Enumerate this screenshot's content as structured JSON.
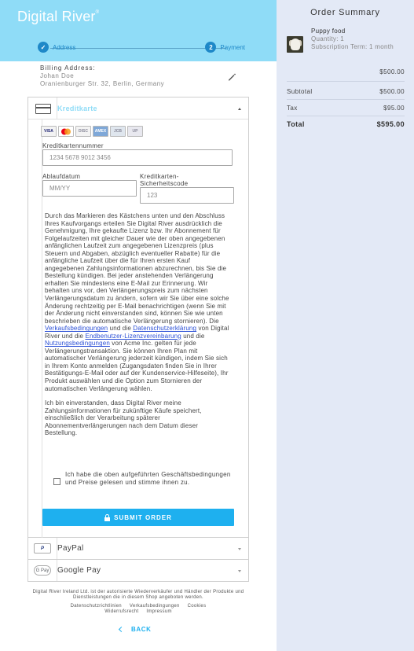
{
  "header": {
    "brand": "Digital River",
    "brand_mark": "®",
    "steps": [
      {
        "label": "Address",
        "done": true
      },
      {
        "label": "Payment",
        "number": "2"
      }
    ]
  },
  "billing": {
    "title": "Billing Address:",
    "name": "Johan Doe",
    "street": "Oranienburger Str. 32, Berlin, Germany"
  },
  "card": {
    "title": "Kreditkarte",
    "brands": [
      "VISA",
      "MC",
      "DISC",
      "AMEX",
      "JCB",
      "UP"
    ],
    "number_label": "Kreditkartennummer",
    "number_placeholder": "1234 5678 9012 3456",
    "expiry_label": "Ablaufdatum",
    "expiry_placeholder": "MM/YY",
    "cvc_label_1": "Kreditkarten-",
    "cvc_label_2": "Sicherheitscode",
    "cvc_placeholder": "123"
  },
  "terms": {
    "p1_a": "Durch das Markieren des Kästchens unten und den Abschluss Ihres Kaufvorgangs erteilen Sie Digital River ausdrücklich die Genehmigung, Ihre gekaufte Lizenz bzw. Ihr Abonnement für Folgelaufzeiten mit gleicher Dauer wie der oben angegebenen anfänglichen Laufzeit zum angegebenen Lizenzpreis (plus Steuern und Abgaben, abzüglich eventueller Rabatte) für die anfängliche Laufzeit über die für Ihren ersten Kauf angegebenen Zahlungsinformationen abzurechnen, bis Sie die Bestellung kündigen. Bei jeder anstehenden Verlängerung erhalten Sie mindestens eine E-Mail zur Erinnerung. Wir behalten uns vor, den Verlängerungspreis zum nächsten Verlängerungsdatum zu ändern, sofern wir Sie über eine solche Änderung rechtzeitig per E-Mail benachrichtigen (wenn Sie mit der Änderung nicht einverstanden sind, können Sie wie unten beschrieben die automatische Verlängerung stornieren). Die ",
    "link1": "Verkaufsbedingungen",
    "p1_b": " und die ",
    "link2": "Datenschutzerklärung",
    "p1_c": " von Digital River und die ",
    "link3": "Endbenutzer-Lizenzvereinbarung",
    "p1_d": " und die ",
    "link4": "Nutzungsbedingungen",
    "p1_e": " von Acme Inc. gelten für jede Verlängerungstransaktion. Sie können Ihren Plan mit automatischer Verlängerung jederzeit kündigen, indem Sie sich in Ihrem Konto anmelden (Zugangsdaten finden Sie in Ihrer Bestätigungs-E-Mail oder auf der Kundenservice-Hilfeseite), Ihr Produkt auswählen und die Option zum Stornieren der automatischen Verlängerung wählen.",
    "p2": "Ich bin einverstanden, dass Digital River meine Zahlungsinformationen für zukünftige Käufe speichert, einschließlich der Verarbeitung späterer Abonnementverlängerungen nach dem Datum dieser Bestellung.",
    "consent": "Ich habe die oben aufgeführten Geschäftsbedingungen und Preise gelesen und stimme ihnen zu."
  },
  "submit_label": "SUBMIT ORDER",
  "paypal": {
    "label": "PayPal",
    "icon": "P"
  },
  "googlepay": {
    "label": "Google Pay",
    "icon": "G Pay"
  },
  "footer": {
    "note": "Digital River Ireland Ltd. ist der autorisierte Wiederverkäufer und Händler der Produkte und Dienstleistungen die in diesem Shop angeboten werden.",
    "links": [
      "Datenschutzrichtlinien",
      "Verkaufsbedingungen",
      "Cookies",
      "Widerrufsrecht",
      "Impressum"
    ],
    "back": "BACK"
  },
  "summary": {
    "title": "Order Summary",
    "product_name": "Puppy food",
    "quantity": "Quantity: 1",
    "term": "Subscription Term: 1 month",
    "line_price": "$500.00",
    "subtotal_label": "Subtotal",
    "subtotal": "$500.00",
    "tax_label": "Tax",
    "tax": "$95.00",
    "total_label": "Total",
    "total": "$595.00"
  }
}
